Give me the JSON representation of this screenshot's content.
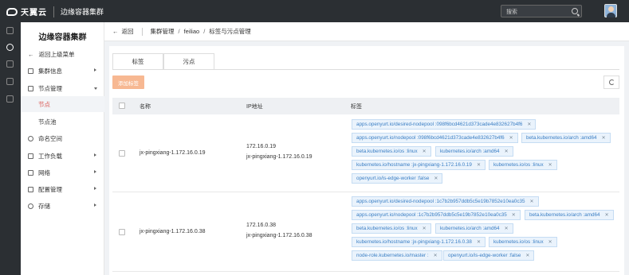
{
  "topbar": {
    "brand": "天翼云",
    "brand_sub": "",
    "product": "边缘容器集群",
    "search_placeholder": "搜索"
  },
  "sidebar": {
    "title": "边缘容器集群",
    "items": [
      {
        "label": "返回上级菜单"
      },
      {
        "label": "集群信息"
      },
      {
        "label": "节点管理"
      },
      {
        "label": "节点"
      },
      {
        "label": "节点池"
      },
      {
        "label": "命名空间"
      },
      {
        "label": "工作负载"
      },
      {
        "label": "网络"
      },
      {
        "label": "配置管理"
      },
      {
        "label": "存储"
      }
    ]
  },
  "breadcrumb": {
    "back": "返回",
    "path": [
      "集群管理",
      "feiliao",
      "标签与污点管理"
    ]
  },
  "tabs": [
    {
      "label": "标签"
    },
    {
      "label": "污点"
    }
  ],
  "add_button": "添加标签",
  "table": {
    "headers": {
      "name": "名称",
      "ip": "IP地址",
      "labels": "标签"
    },
    "rows": [
      {
        "name": "jx-pingxiang-1.172.16.0.19",
        "ip": [
          "172.16.0.19",
          "jx-pingxiang-1.172.16.0.19"
        ],
        "tags": [
          "apps.openyurt.io/desired-nodepool :098f6bcd4621d373cade4e832627b4f6",
          "apps.openyurt.io/nodepool :098f6bcd4621d373cade4e832627b4f6",
          "beta.kubernetes.io/arch :amd64",
          "beta.kubernetes.io/os :linux",
          "kubernetes.io/arch :amd64",
          "kubernetes.io/hostname :jx-pingxiang-1.172.16.0.19",
          "kubernetes.io/os :linux",
          "openyurt.io/is-edge-worker :false"
        ]
      },
      {
        "name": "jx-pingxiang-1.172.16.0.38",
        "ip": [
          "172.16.0.38",
          "jx-pingxiang-1.172.16.0.38"
        ],
        "tags": [
          "apps.openyurt.io/desired-nodepool :1c7b2b957ddb5c5e19b7852e10ea0c35",
          "apps.openyurt.io/nodepool :1c7b2b957ddb5c5e19b7852e10ea0c35",
          "beta.kubernetes.io/arch :amd64",
          "beta.kubernetes.io/os :linux",
          "kubernetes.io/arch :amd64",
          "kubernetes.io/hostname :jx-pingxiang-1.172.16.0.38",
          "kubernetes.io/os :linux",
          "node-role.kubernetes.io/master :",
          "openyurt.io/is-edge-worker :false"
        ]
      }
    ]
  },
  "colors": {
    "accent": "#d9534f",
    "tag_bg": "#eaf3fc",
    "tag_text": "#3a7ec4",
    "topbar": "#2b2f33",
    "add_button": "#f7b892"
  }
}
